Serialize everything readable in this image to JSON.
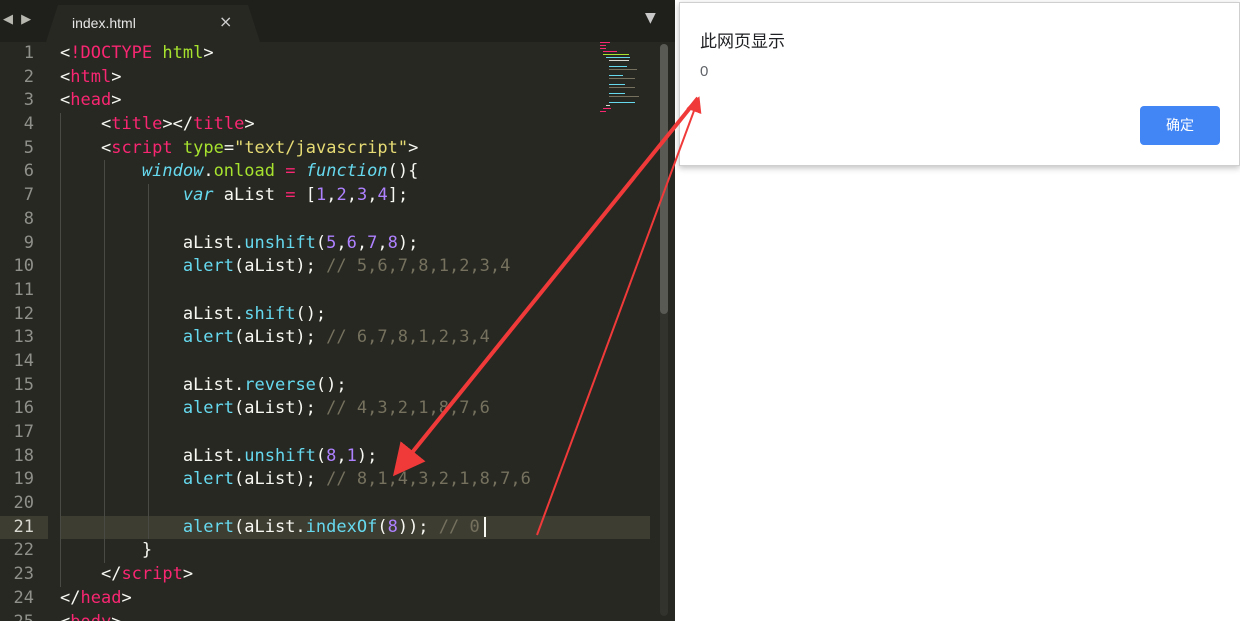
{
  "editor": {
    "tab_title": "index.html",
    "close_glyph": "×",
    "nav_glyphs": "◀ ▶",
    "dropdown_glyph": "▼",
    "active_line": 21,
    "line_numbers": [
      "1",
      "2",
      "3",
      "4",
      "5",
      "6",
      "7",
      "8",
      "9",
      "10",
      "11",
      "12",
      "13",
      "14",
      "15",
      "16",
      "17",
      "18",
      "19",
      "20",
      "21",
      "22",
      "23",
      "24",
      "25"
    ],
    "tokens": {
      "lt": "<",
      "gt": ">",
      "lt_slash": "</",
      "bang": "!",
      "doctype": "DOCTYPE",
      "html": "html",
      "head": "head",
      "title": "title",
      "script": "script",
      "type_attr": "type",
      "eq": "=",
      "type_val": "\"text/javascript\"",
      "window": "window",
      "dot": ".",
      "onload": "onload",
      "function": "function",
      "parens_brace": "(){",
      "var": "var",
      "alist": "aList",
      "lbracket": "[",
      "rbracket": "];",
      "comma": ",",
      "unshift": "unshift",
      "shift": "shift",
      "reverse": "reverse",
      "alert": "alert",
      "indexof": "indexOf",
      "lparen": "(",
      "rparen_semi": ");",
      "empty_call": "();",
      "alert_call": "(aList);",
      "alert_indexof_open": "(aList.",
      "alert_indexof_close": "));",
      "close_brace": "}",
      "n1": "1",
      "n2": "2",
      "n3": "3",
      "n4": "4",
      "n5": "5",
      "n6": "6",
      "n7": "7",
      "n8": "8"
    },
    "comments": {
      "c10": "// 5,6,7,8,1,2,3,4",
      "c13": "// 6,7,8,1,2,3,4",
      "c16": "// 4,3,2,1,8,7,6",
      "c19": "// 8,1,4,3,2,1,8,7,6",
      "c21": "// 0"
    }
  },
  "dialog": {
    "title": "此网页显示",
    "message": "0",
    "ok_label": "确定"
  },
  "colors": {
    "editor_bg": "#272822",
    "annotation_arrow": "#f03a3a",
    "dialog_button": "#4285f4"
  },
  "icons": [
    "back-icon",
    "forward-icon",
    "close-icon",
    "chevron-down-icon"
  ]
}
